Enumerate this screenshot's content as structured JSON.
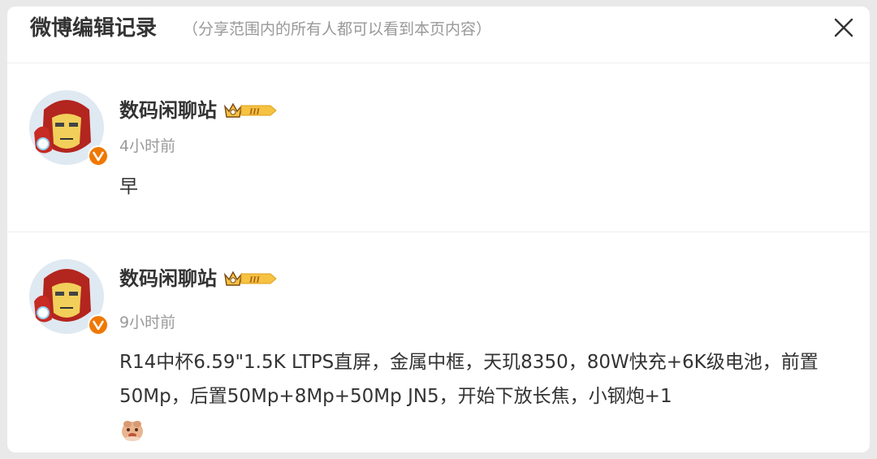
{
  "header": {
    "title": "微博编辑记录",
    "subtitle": "（分享范围内的所有人都可以看到本页内容）"
  },
  "entries": [
    {
      "username": "数码闲聊站",
      "timestamp": "4小时前",
      "content": "早"
    },
    {
      "username": "数码闲聊站",
      "timestamp": "9小时前",
      "content": "R14中杯6.59\"1.5K LTPS直屏，金属中框，天玑8350，80W快充+6K级电池，前置50Mp，后置50Mp+8Mp+50Mp JN5，开始下放长焦，小钢炮+1"
    }
  ],
  "badges": {
    "vip_level": "III"
  },
  "colors": {
    "verified_badge": "#f07800",
    "vip_gold": "#f5c242",
    "text_primary": "#333333",
    "text_secondary": "#999999"
  },
  "icons": {
    "close": "close-icon",
    "verified": "verified-v-icon",
    "vip": "vip-crown-icon",
    "emoji": "doge-emoji-icon"
  }
}
